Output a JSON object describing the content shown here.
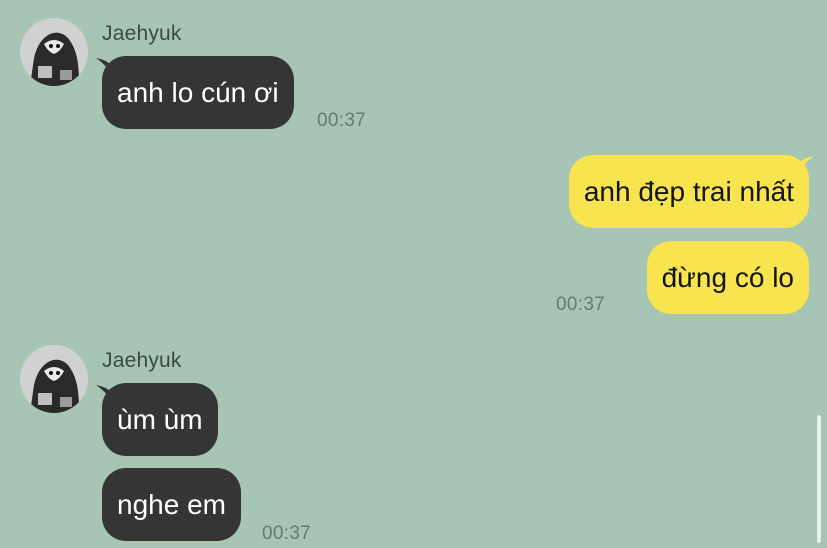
{
  "messages": [
    {
      "sender": "Jaehyuk",
      "text": "anh lo cún ơi",
      "time": "00:37"
    },
    {
      "text": "anh đẹp trai nhất"
    },
    {
      "text": "đừng có lo",
      "time": "00:37"
    },
    {
      "sender": "Jaehyuk",
      "text": "ùm ùm"
    },
    {
      "text": "nghe em",
      "time": "00:37"
    }
  ],
  "colors": {
    "background": "#a7c5b4",
    "incoming_bubble": "#353536",
    "outgoing_bubble": "#f7e44e"
  }
}
